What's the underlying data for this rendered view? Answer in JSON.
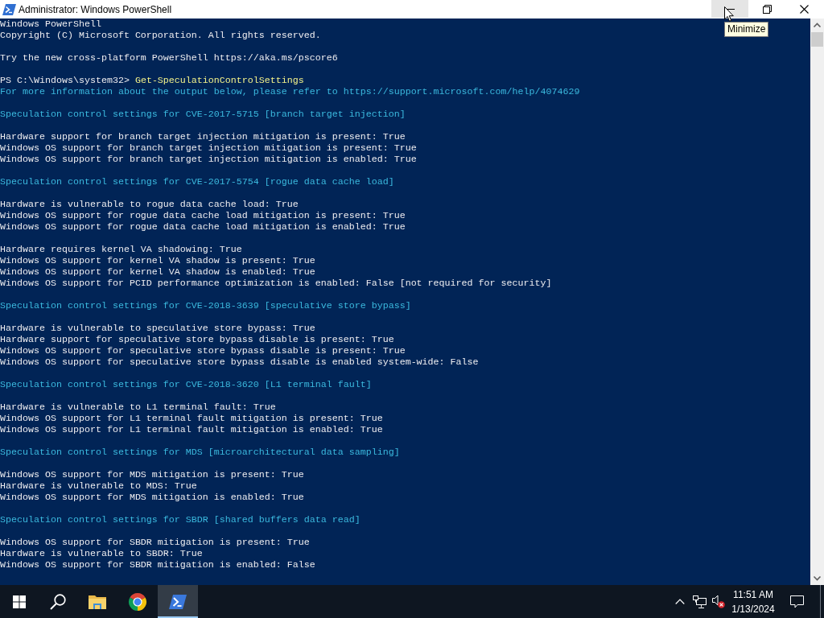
{
  "window": {
    "title": "Administrator: Windows PowerShell",
    "buttons": [
      {
        "kind": "minimize",
        "hovered": true
      },
      {
        "kind": "restore",
        "hovered": false
      },
      {
        "kind": "close",
        "hovered": false
      }
    ]
  },
  "tooltip": {
    "text": "Minimize"
  },
  "console": {
    "blocks": [
      [
        {
          "kind": "output",
          "text": "Windows PowerShell"
        },
        {
          "kind": "output",
          "text": "Copyright (C) Microsoft Corporation. All rights reserved."
        }
      ],
      [
        {
          "kind": "output",
          "text": "Try the new cross-platform PowerShell https://aka.ms/pscore6"
        }
      ],
      [
        {
          "kind": "prompt",
          "prompt": "PS C:\\Windows\\system32>",
          "command": "Get-SpeculationControlSettings"
        },
        {
          "kind": "notice",
          "text": "For more information about the output below, please refer to https://support.microsoft.com/help/4074629"
        }
      ],
      [
        {
          "kind": "notice",
          "text": "Speculation control settings for CVE-2017-5715 [branch target injection]"
        }
      ],
      [
        {
          "kind": "output",
          "text": "Hardware support for branch target injection mitigation is present: True"
        },
        {
          "kind": "output",
          "text": "Windows OS support for branch target injection mitigation is present: True"
        },
        {
          "kind": "output",
          "text": "Windows OS support for branch target injection mitigation is enabled: True"
        }
      ],
      [
        {
          "kind": "notice",
          "text": "Speculation control settings for CVE-2017-5754 [rogue data cache load]"
        }
      ],
      [
        {
          "kind": "output",
          "text": "Hardware is vulnerable to rogue data cache load: True"
        },
        {
          "kind": "output",
          "text": "Windows OS support for rogue data cache load mitigation is present: True"
        },
        {
          "kind": "output",
          "text": "Windows OS support for rogue data cache load mitigation is enabled: True"
        }
      ],
      [
        {
          "kind": "output",
          "text": "Hardware requires kernel VA shadowing: True"
        },
        {
          "kind": "output",
          "text": "Windows OS support for kernel VA shadow is present: True"
        },
        {
          "kind": "output",
          "text": "Windows OS support for kernel VA shadow is enabled: True"
        },
        {
          "kind": "output",
          "text": "Windows OS support for PCID performance optimization is enabled: False [not required for security]"
        }
      ],
      [
        {
          "kind": "notice",
          "text": "Speculation control settings for CVE-2018-3639 [speculative store bypass]"
        }
      ],
      [
        {
          "kind": "output",
          "text": "Hardware is vulnerable to speculative store bypass: True"
        },
        {
          "kind": "output",
          "text": "Hardware support for speculative store bypass disable is present: True"
        },
        {
          "kind": "output",
          "text": "Windows OS support for speculative store bypass disable is present: True"
        },
        {
          "kind": "output",
          "text": "Windows OS support for speculative store bypass disable is enabled system-wide: False"
        }
      ],
      [
        {
          "kind": "notice",
          "text": "Speculation control settings for CVE-2018-3620 [L1 terminal fault]"
        }
      ],
      [
        {
          "kind": "output",
          "text": "Hardware is vulnerable to L1 terminal fault: True"
        },
        {
          "kind": "output",
          "text": "Windows OS support for L1 terminal fault mitigation is present: True"
        },
        {
          "kind": "output",
          "text": "Windows OS support for L1 terminal fault mitigation is enabled: True"
        }
      ],
      [
        {
          "kind": "notice",
          "text": "Speculation control settings for MDS [microarchitectural data sampling]"
        }
      ],
      [
        {
          "kind": "output",
          "text": "Windows OS support for MDS mitigation is present: True"
        },
        {
          "kind": "output",
          "text": "Hardware is vulnerable to MDS: True"
        },
        {
          "kind": "output",
          "text": "Windows OS support for MDS mitigation is enabled: True"
        }
      ],
      [
        {
          "kind": "notice",
          "text": "Speculation control settings for SBDR [shared buffers data read]"
        }
      ],
      [
        {
          "kind": "output",
          "text": "Windows OS support for SBDR mitigation is present: True"
        },
        {
          "kind": "output",
          "text": "Hardware is vulnerable to SBDR: True"
        },
        {
          "kind": "output",
          "text": "Windows OS support for SBDR mitigation is enabled: False"
        }
      ]
    ]
  },
  "taskbar": {
    "buttons": [
      {
        "kind": "start"
      },
      {
        "kind": "search"
      }
    ],
    "apps": [
      {
        "kind": "files",
        "active": false
      },
      {
        "kind": "browser",
        "active": false
      },
      {
        "kind": "terminal",
        "active": true
      }
    ]
  },
  "tray": {
    "sound_error": true,
    "time": "11:51 AM",
    "date": "1/13/2024"
  }
}
